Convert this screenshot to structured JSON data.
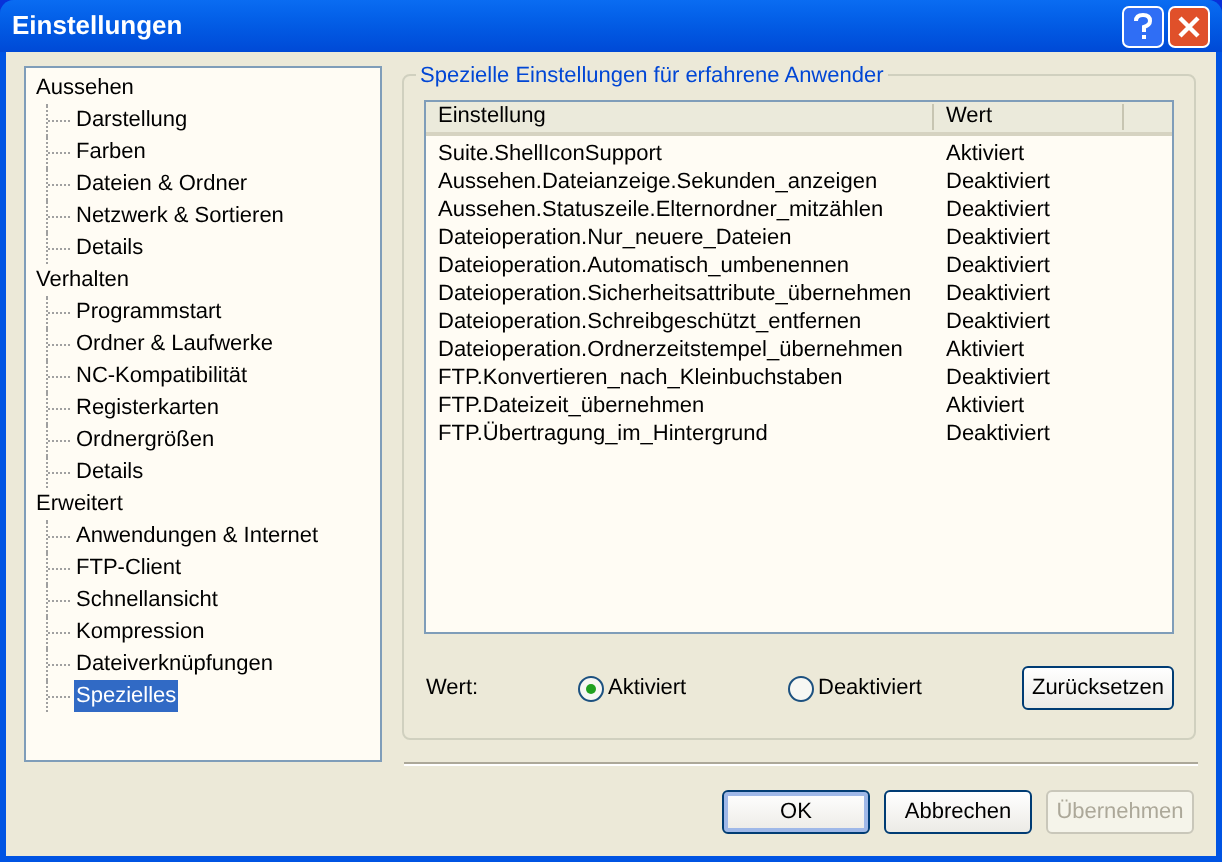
{
  "window": {
    "title": "Einstellungen"
  },
  "tree": [
    {
      "label": "Aussehen",
      "selected": false,
      "children": [
        {
          "label": "Darstellung",
          "selected": false
        },
        {
          "label": "Farben",
          "selected": false
        },
        {
          "label": "Dateien & Ordner",
          "selected": false
        },
        {
          "label": "Netzwerk & Sortieren",
          "selected": false
        },
        {
          "label": "Details",
          "selected": false
        }
      ]
    },
    {
      "label": "Verhalten",
      "selected": false,
      "children": [
        {
          "label": "Programmstart",
          "selected": false
        },
        {
          "label": "Ordner & Laufwerke",
          "selected": false
        },
        {
          "label": "NC-Kompatibilität",
          "selected": false
        },
        {
          "label": "Registerkarten",
          "selected": false
        },
        {
          "label": "Ordnergrößen",
          "selected": false
        },
        {
          "label": "Details",
          "selected": false
        }
      ]
    },
    {
      "label": "Erweitert",
      "selected": false,
      "children": [
        {
          "label": "Anwendungen & Internet",
          "selected": false
        },
        {
          "label": "FTP-Client",
          "selected": false
        },
        {
          "label": "Schnellansicht",
          "selected": false
        },
        {
          "label": "Kompression",
          "selected": false
        },
        {
          "label": "Dateiverknüpfungen",
          "selected": false
        },
        {
          "label": "Spezielles",
          "selected": true
        }
      ]
    }
  ],
  "group": {
    "title": "Spezielle Einstellungen für erfahrene Anwender",
    "table": {
      "columns": [
        "Einstellung",
        "Wert"
      ],
      "rows": [
        {
          "setting": "Suite.ShellIconSupport",
          "value": "Aktiviert"
        },
        {
          "setting": "Aussehen.Dateianzeige.Sekunden_anzeigen",
          "value": "Deaktiviert"
        },
        {
          "setting": "Aussehen.Statuszeile.Elternordner_mitzählen",
          "value": "Deaktiviert"
        },
        {
          "setting": "Dateioperation.Nur_neuere_Dateien",
          "value": "Deaktiviert"
        },
        {
          "setting": "Dateioperation.Automatisch_umbenennen",
          "value": "Deaktiviert"
        },
        {
          "setting": "Dateioperation.Sicherheitsattribute_übernehmen",
          "value": "Deaktiviert"
        },
        {
          "setting": "Dateioperation.Schreibgeschützt_entfernen",
          "value": "Deaktiviert"
        },
        {
          "setting": "Dateioperation.Ordnerzeitstempel_übernehmen",
          "value": "Aktiviert"
        },
        {
          "setting": "FTP.Konvertieren_nach_Kleinbuchstaben",
          "value": "Deaktiviert"
        },
        {
          "setting": "FTP.Dateizeit_übernehmen",
          "value": "Aktiviert"
        },
        {
          "setting": "FTP.Übertragung_im_Hintergrund",
          "value": "Deaktiviert"
        }
      ]
    },
    "value_label": "Wert:",
    "options": [
      {
        "label": "Aktiviert",
        "selected": true
      },
      {
        "label": "Deaktiviert",
        "selected": false
      }
    ],
    "reset_button": "Zurücksetzen"
  },
  "buttons": [
    {
      "label": "OK",
      "default": true,
      "disabled": false
    },
    {
      "label": "Abbrechen",
      "default": false,
      "disabled": false
    },
    {
      "label": "Übernehmen",
      "default": false,
      "disabled": true
    }
  ]
}
